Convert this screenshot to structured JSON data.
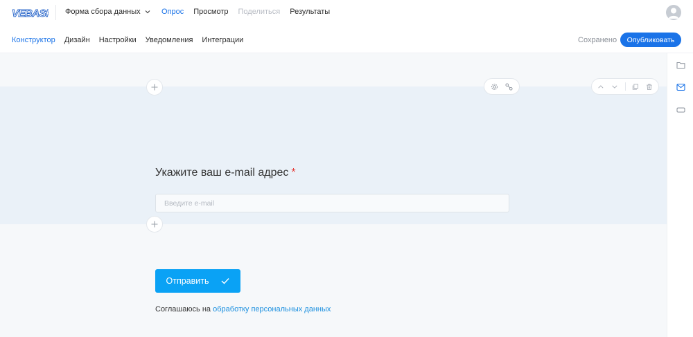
{
  "header": {
    "logo_text": "VEBASK",
    "form_name": "Форма сбора данных",
    "nav": [
      {
        "label": "Опрос",
        "state": "active"
      },
      {
        "label": "Просмотр",
        "state": "normal"
      },
      {
        "label": "Поделиться",
        "state": "disabled"
      },
      {
        "label": "Результаты",
        "state": "normal"
      }
    ]
  },
  "subheader": {
    "tabs": [
      "Конструктор",
      "Дизайн",
      "Настройки",
      "Уведомления",
      "Интеграции"
    ],
    "active_tab": "Конструктор",
    "saved_label": "Сохранено",
    "publish_label": "Опубликовать"
  },
  "question": {
    "title": "Укажите ваш e-mail адрес",
    "required_mark": "*",
    "input_placeholder": "Введите e-mail",
    "input_value": ""
  },
  "form_footer": {
    "submit_label": "Отправить",
    "consent_prefix": "Соглашаюсь на ",
    "consent_link": "обработку персональных данных"
  },
  "colors": {
    "accent": "#1a73e8",
    "submit": "#0aa2f5",
    "required": "#e53935",
    "question_bg": "#eaf1f8",
    "canvas_bg": "#f6f8fa"
  },
  "icons": {
    "form_dropdown": "chevron-down-icon",
    "avatar": "user-avatar-icon",
    "question_settings": "gear-icon",
    "question_logic": "logic-icon",
    "move_up": "chevron-up-icon",
    "move_down": "chevron-down-icon",
    "duplicate": "copy-icon",
    "delete": "trash-icon",
    "add_block": "plus-icon",
    "rail": [
      "folder-icon",
      "mail-icon",
      "input-field-icon"
    ],
    "submit": "checkmark-icon"
  }
}
